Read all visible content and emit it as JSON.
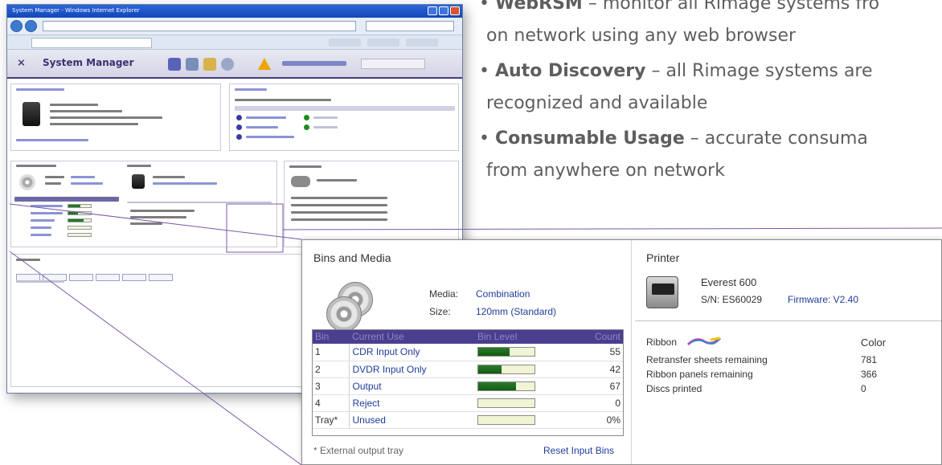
{
  "bullets": [
    {
      "bold": "WebRSM",
      "rest": " – monitor all Rimage systems fro",
      "cont": "on network using any web browser"
    },
    {
      "bold": "Auto Discovery",
      "rest": " – all Rimage systems are",
      "cont": "recognized and available"
    },
    {
      "bold": "Consumable Usage",
      "rest": " – accurate consuma",
      "cont": "from anywhere on network"
    }
  ],
  "mini_window": {
    "title": "System Manager - Windows Internet Explorer",
    "app_title": "System Manager"
  },
  "bins_media": {
    "title": "Bins and Media",
    "media_label": "Media:",
    "media_value": "Combination",
    "size_label": "Size:",
    "size_value": "120mm (Standard)",
    "columns": [
      "Bin",
      "Current Use",
      "Bin Level",
      "Count"
    ],
    "rows": [
      {
        "bin": "1",
        "use": "CDR Input Only",
        "level": 0.55,
        "count": "55"
      },
      {
        "bin": "2",
        "use": "DVDR Input Only",
        "level": 0.42,
        "count": "42"
      },
      {
        "bin": "3",
        "use": "Output",
        "level": 0.67,
        "count": "67"
      },
      {
        "bin": "4",
        "use": "Reject",
        "level": 0.0,
        "count": "0"
      },
      {
        "bin": "Tray*",
        "use": "Unused",
        "level": 0.0,
        "count": "0%"
      }
    ],
    "footnote": "* External output tray",
    "reset_label": "Reset Input Bins"
  },
  "printer": {
    "title": "Printer",
    "name": "Everest 600",
    "serial": "S/N: ES60029",
    "firmware": "Firmware: V2.40",
    "ribbon_label": "Ribbon",
    "color_label": "Color",
    "rows": [
      {
        "label": "Retransfer sheets remaining",
        "value": "781"
      },
      {
        "label": "Ribbon panels remaining",
        "value": "366"
      },
      {
        "label": "Discs printed",
        "value": "0"
      }
    ]
  },
  "colors": {
    "header_purple": "#4a3f8f",
    "link_blue": "#1f3c9c",
    "level_green": "#1f7a1f",
    "connector": "#7a5aa6"
  }
}
